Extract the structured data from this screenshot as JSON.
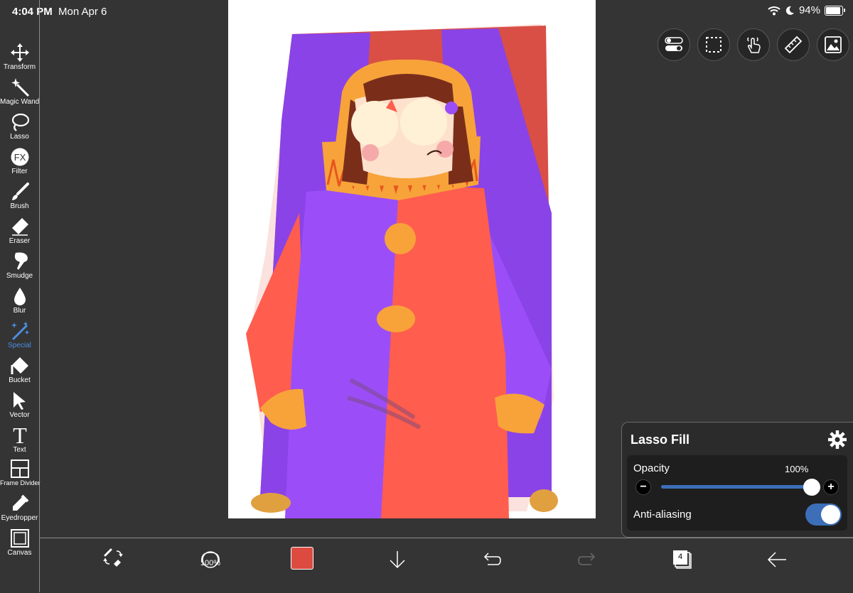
{
  "status": {
    "time": "4:04 PM",
    "date": "Mon Apr 6",
    "battery": "94%"
  },
  "tools": [
    {
      "label": "Transform",
      "icon": "move-arrows-icon"
    },
    {
      "label": "Magic Wand",
      "icon": "magic-wand-icon"
    },
    {
      "label": "Lasso",
      "icon": "lasso-icon"
    },
    {
      "label": "Filter",
      "icon": "fx-icon"
    },
    {
      "label": "Brush",
      "icon": "brush-icon"
    },
    {
      "label": "Eraser",
      "icon": "eraser-icon"
    },
    {
      "label": "Smudge",
      "icon": "smudge-icon"
    },
    {
      "label": "Blur",
      "icon": "blur-drop-icon"
    },
    {
      "label": "Special",
      "icon": "special-wand-icon",
      "active": true
    },
    {
      "label": "Bucket",
      "icon": "bucket-icon"
    },
    {
      "label": "Vector",
      "icon": "vector-arrow-icon"
    },
    {
      "label": "Text",
      "icon": "text-t-icon"
    },
    {
      "label": "Frame Divider",
      "icon": "frame-divider-icon"
    },
    {
      "label": "Eyedropper",
      "icon": "eyedropper-icon"
    },
    {
      "label": "Canvas",
      "icon": "canvas-icon"
    }
  ],
  "top_icons": [
    "toggles-icon",
    "selection-icon",
    "gesture-icon",
    "ruler-icon",
    "reference-image-icon"
  ],
  "panel": {
    "title": "Lasso Fill",
    "opacity_label": "Opacity",
    "opacity_value": "100%",
    "opacity_fraction": 1.0,
    "minus": "−",
    "plus": "+",
    "antialias_label": "Anti-aliasing",
    "antialias_on": true
  },
  "bottom": {
    "brush_size": "100%",
    "color": "#dd4a40",
    "layers_count": "4"
  },
  "colors": {
    "accent": "#3d6fb8",
    "active_tool": "#4a8fe0",
    "background": "#343434"
  }
}
